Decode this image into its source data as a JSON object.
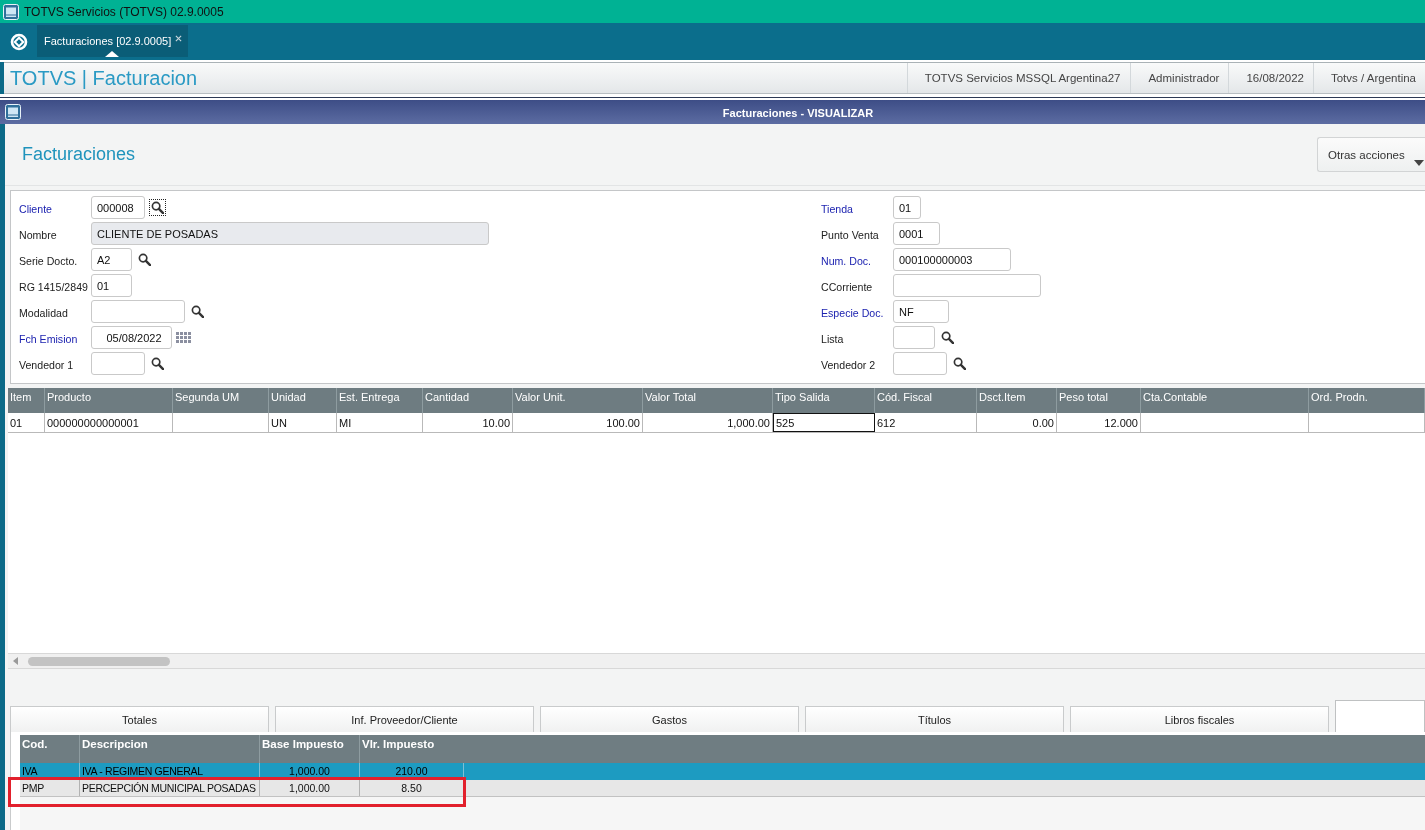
{
  "window": {
    "title": "TOTVS Servicios (TOTVS) 02.9.0005"
  },
  "app_tabs": [
    {
      "label": "Facturaciones [02.9.0005]",
      "selected": true
    }
  ],
  "header": {
    "title": "TOTVS | Facturacion",
    "info": [
      "TOTVS Servicios MSSQL Argentina27",
      "Administrador",
      "16/08/2022",
      "Totvs / Argentina"
    ]
  },
  "dialog": {
    "title": "Facturaciones - VISUALIZAR",
    "heading": "Facturaciones",
    "actions_button": "Otras acciones"
  },
  "form": {
    "left": [
      {
        "kind": "search",
        "label": "Cliente",
        "value": "000008",
        "required": true,
        "disabled": false,
        "lookup_focused": true
      },
      {
        "kind": "plain",
        "label": "Nombre",
        "value": "CLIENTE DE POSADAS",
        "required": false,
        "disabled": true
      },
      {
        "kind": "search",
        "label": "Serie Docto.",
        "value": "A2",
        "required": false,
        "disabled": false,
        "lookup_focused": false
      },
      {
        "kind": "plain",
        "label": "RG 1415/2849",
        "value": "01",
        "required": false,
        "disabled": false
      },
      {
        "kind": "search",
        "label": "Modalidad",
        "required": false,
        "disabled": false,
        "lookup_focused": false
      },
      {
        "kind": "date",
        "label": "Fch Emision",
        "value": "05/08/2022",
        "required": true,
        "disabled": false
      },
      {
        "kind": "search",
        "label": "Vendedor 1",
        "required": false,
        "disabled": false,
        "lookup_focused": false
      }
    ],
    "right": [
      {
        "kind": "plain",
        "label": "Tienda",
        "value": "01",
        "required": true,
        "disabled": false
      },
      {
        "kind": "plain",
        "label": "Punto Venta",
        "value": "0001",
        "required": false,
        "disabled": false
      },
      {
        "kind": "plain",
        "label": "Num. Doc.",
        "value": "000100000003",
        "required": true,
        "disabled": false
      },
      {
        "kind": "plain",
        "label": "CCorriente",
        "required": false,
        "disabled": false
      },
      {
        "kind": "plain",
        "label": "Especie Doc.",
        "value": "NF",
        "required": true,
        "disabled": false
      },
      {
        "kind": "search",
        "label": "Lista",
        "required": false,
        "disabled": false,
        "lookup_focused": false
      },
      {
        "kind": "search",
        "label": "Vendedor 2",
        "required": false,
        "disabled": false,
        "lookup_focused": false
      }
    ]
  },
  "items_table": {
    "columns": [
      {
        "label": "Item",
        "kind": "text"
      },
      {
        "label": "Producto",
        "kind": "text"
      },
      {
        "label": "Segunda UM",
        "kind": "text"
      },
      {
        "label": "Unidad",
        "kind": "text"
      },
      {
        "label": "Est. Entrega",
        "kind": "text"
      },
      {
        "label": "Cantidad",
        "kind": "number"
      },
      {
        "label": "Valor Unit.",
        "kind": "number"
      },
      {
        "label": "Valor Total",
        "kind": "number"
      },
      {
        "label": "Tipo Salida",
        "kind": "text"
      },
      {
        "label": "Cód. Fiscal",
        "kind": "text"
      },
      {
        "label": "Dsct.Item",
        "kind": "number"
      },
      {
        "label": "Peso total",
        "kind": "number"
      },
      {
        "label": "Cta.Contable",
        "kind": "text"
      },
      {
        "label": "Ord. Prodn.",
        "kind": "text"
      }
    ],
    "rows": [
      {
        "cells": [
          {
            "text": "01",
            "focused": false
          },
          {
            "text": "000000000000001",
            "focused": false
          },
          {
            "focused": false
          },
          {
            "text": "UN",
            "focused": false
          },
          {
            "text": "MI",
            "focused": false
          },
          {
            "text": "10.00",
            "focused": false
          },
          {
            "text": "100.00",
            "focused": false
          },
          {
            "text": "1,000.00",
            "focused": false
          },
          {
            "text": "525",
            "focused": true
          },
          {
            "text": "612",
            "focused": false
          },
          {
            "text": "0.00",
            "focused": false
          },
          {
            "text": "12.000",
            "focused": false
          },
          {
            "focused": false
          },
          {
            "focused": false
          }
        ]
      }
    ]
  },
  "bottom_tabs": [
    {
      "label": "Totales",
      "selected": false
    },
    {
      "label": "Inf. Proveedor/Cliente",
      "selected": false
    },
    {
      "label": "Gastos",
      "selected": false
    },
    {
      "label": "Títulos",
      "selected": false
    },
    {
      "label": "Libros fiscales",
      "selected": false
    },
    {
      "selected": true
    }
  ],
  "tax_table": {
    "columns": [
      {
        "label": "Cod.",
        "kind": "text"
      },
      {
        "label": "Descripcion",
        "kind": "text"
      },
      {
        "label": "Base Impuesto",
        "kind": "number"
      },
      {
        "label": "Vlr. Impuesto",
        "kind": "number"
      }
    ],
    "rows": [
      {
        "cells": [
          "IVA",
          "IVA - REGIMEN GENERAL",
          "1,000.00",
          "210.00"
        ],
        "selected": true,
        "highlighted": false
      },
      {
        "cells": [
          "PMP",
          "PERCEPCIÓN MUNICIPAL POSADAS",
          "1,000.00",
          "8.50"
        ],
        "selected": false,
        "highlighted": true
      }
    ]
  }
}
